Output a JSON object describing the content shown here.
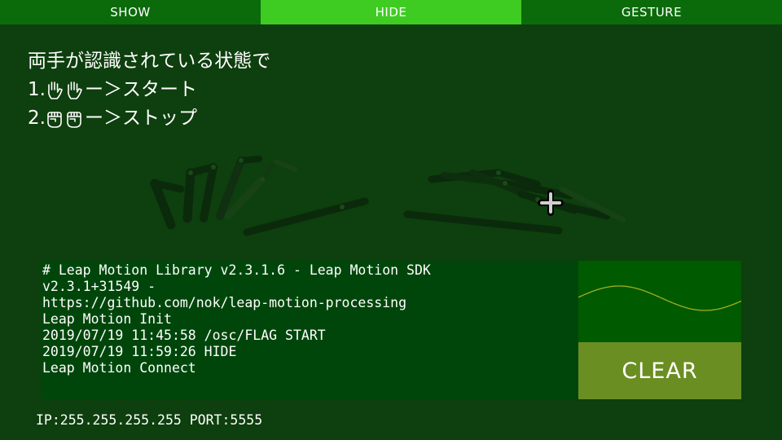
{
  "tabs": [
    {
      "label": "SHOW",
      "active": false
    },
    {
      "label": "HIDE",
      "active": true
    },
    {
      "label": "GESTURE",
      "active": false
    }
  ],
  "instructions": {
    "line1": "両手が認識されている状態で",
    "line2_prefix": "1.",
    "line2_icons": [
      "open-hand-icon",
      "open-hand-icon"
    ],
    "line2_suffix": "ー＞スタート",
    "line3_prefix": "2.",
    "line3_icons": [
      "fist-icon",
      "fist-icon"
    ],
    "line3_suffix": "ー＞ストップ"
  },
  "console": {
    "lines": [
      "# Leap Motion Library v2.3.1.6 - Leap Motion SDK",
      "v2.3.1+31549 -",
      "https://github.com/nok/leap-motion-processing",
      "Leap Motion Init",
      "2019/07/19 11:45:58 /osc/FLAG START",
      "2019/07/19 11:59:26 HIDE",
      "Leap Motion Connect"
    ]
  },
  "clear_button": {
    "label": "CLEAR"
  },
  "status_bar": {
    "text": "IP:255.255.255.255 PORT:5555"
  },
  "colors": {
    "background": "#0e3f0e",
    "tab": "#0b6b0b",
    "tab_active": "#3fcc22",
    "console_bg": "#00460b",
    "wave_bg": "#005a00",
    "wave_line": "#a0b020",
    "clear_button": "#6b8e23"
  }
}
